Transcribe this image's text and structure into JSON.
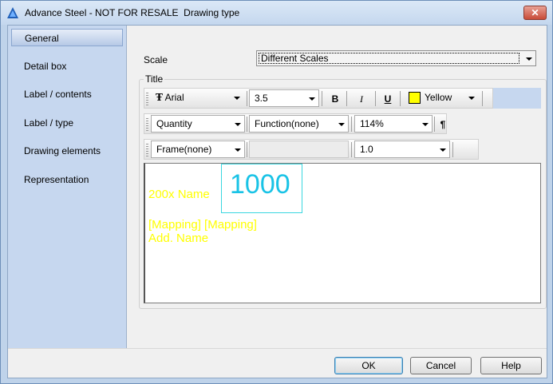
{
  "window": {
    "title": "Advance Steel - NOT FOR RESALE  Drawing type",
    "close_label": "✕"
  },
  "sidebar": {
    "items": [
      {
        "label": "General",
        "selected": true
      },
      {
        "label": "Detail box"
      },
      {
        "label": "Label / contents"
      },
      {
        "label": "Label / type"
      },
      {
        "label": "Drawing elements"
      },
      {
        "label": "Representation"
      }
    ]
  },
  "scale": {
    "label": "Scale",
    "value": "Different Scales"
  },
  "title_group": {
    "legend": "Title",
    "font": "Arial",
    "font_glyph": "Ŧ",
    "size": "3.5",
    "bold": "B",
    "italic": "I",
    "underline": "U",
    "color_name": "Yellow",
    "color_hex": "#ffff00",
    "quantity": "Quantity",
    "function": "Function(none)",
    "percent": "114%",
    "paragraph": "¶",
    "frame": "Frame(none)",
    "spacing": "1.0"
  },
  "preview": {
    "name_line": "200x Name",
    "big_number": "1000",
    "mapping_line": "[Mapping] [Mapping]",
    "add_name_line": "Add. Name"
  },
  "buttons": {
    "ok": "OK",
    "cancel": "Cancel",
    "help": "Help"
  },
  "colors": {
    "accent": "#3c7fb1",
    "preview_text": "#ffff00",
    "preview_number": "#19c3e6"
  }
}
